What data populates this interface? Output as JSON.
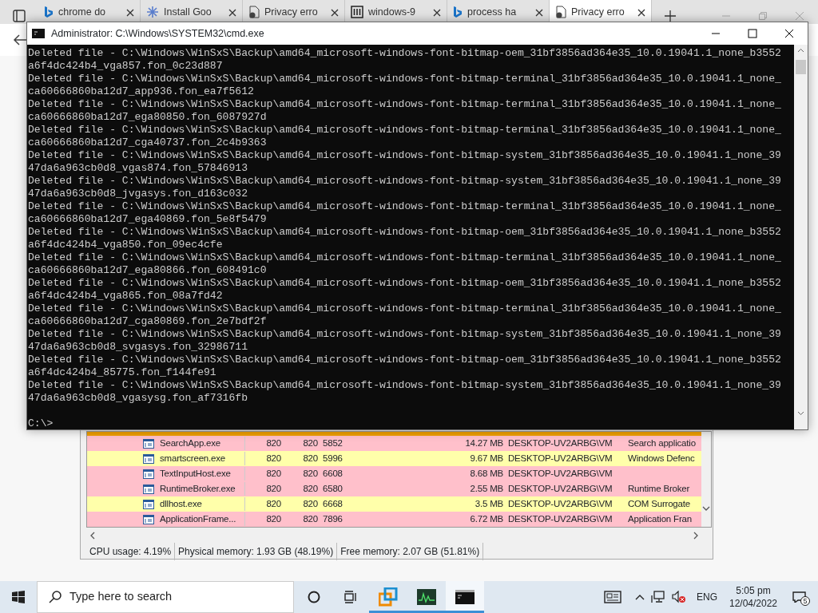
{
  "browser": {
    "tabs": [
      {
        "label": "chrome do",
        "kind": "bing",
        "selected": false
      },
      {
        "label": "Install Goo",
        "kind": "spark",
        "selected": false
      },
      {
        "label": "Privacy erro",
        "kind": "warning",
        "selected": false
      },
      {
        "label": "windows-9",
        "kind": "pillars",
        "selected": false
      },
      {
        "label": "process ha",
        "kind": "bing",
        "selected": false
      },
      {
        "label": "Privacy erro",
        "kind": "warning",
        "selected": true
      }
    ]
  },
  "process_explorer": {
    "rows": [
      {
        "cells": [
          "SearchApp.exe",
          "820",
          "820",
          "5852",
          "14.27 MB",
          "DESKTOP-UV2ARBG\\VM",
          "Search applicatio"
        ],
        "color": "#ffc0cb"
      },
      {
        "cells": [
          "smartscreen.exe",
          "820",
          "820",
          "5996",
          "9.67 MB",
          "DESKTOP-UV2ARBG\\VM",
          "Windows Defenc"
        ],
        "color": "#ffffaa"
      },
      {
        "cells": [
          "TextInputHost.exe",
          "820",
          "820",
          "6608",
          "8.68 MB",
          "DESKTOP-UV2ARBG\\VM"
        ],
        "color": "#ffc0cb"
      },
      {
        "cells": [
          "RuntimeBroker.exe",
          "820",
          "820",
          "6580",
          "2.55 MB",
          "DESKTOP-UV2ARBG\\VM",
          "Runtime Broker"
        ],
        "color": "#ffc0cb"
      },
      {
        "cells": [
          "dllhost.exe",
          "820",
          "820",
          "6668",
          "3.5 MB",
          "DESKTOP-UV2ARBG\\VM",
          "COM Surrogate"
        ],
        "color": "#ffffaa"
      },
      {
        "cells": [
          "ApplicationFrame...",
          "820",
          "820",
          "7896",
          "6.72 MB",
          "DESKTOP-UV2ARBG\\VM",
          "Application Fran"
        ],
        "color": "#ffc0cb"
      }
    ],
    "status_bar": [
      "CPU usage: 4.19%",
      "Physical memory: 1.93 GB (48.19%)",
      "Free memory: 2.07 GB (51.81%)"
    ]
  },
  "cmd": {
    "title": "Administrator: C:\\Windows\\SYSTEM32\\cmd.exe",
    "lines": [
      "Deleted file - C:\\Windows\\WinSxS\\Backup\\amd64_microsoft-windows-font-bitmap-oem_31bf3856ad364e35_10.0.19041.1_none_b3552",
      "a6f4dc424b4_vga857.fon_0c23d887",
      "Deleted file - C:\\Windows\\WinSxS\\Backup\\amd64_microsoft-windows-font-bitmap-terminal_31bf3856ad364e35_10.0.19041.1_none_",
      "ca60666860ba12d7_app936.fon_ea7f5612",
      "Deleted file - C:\\Windows\\WinSxS\\Backup\\amd64_microsoft-windows-font-bitmap-terminal_31bf3856ad364e35_10.0.19041.1_none_",
      "ca60666860ba12d7_ega80850.fon_6087927d",
      "Deleted file - C:\\Windows\\WinSxS\\Backup\\amd64_microsoft-windows-font-bitmap-terminal_31bf3856ad364e35_10.0.19041.1_none_",
      "ca60666860ba12d7_cga40737.fon_2c4b9363",
      "Deleted file - C:\\Windows\\WinSxS\\Backup\\amd64_microsoft-windows-font-bitmap-system_31bf3856ad364e35_10.0.19041.1_none_39",
      "47da6a963cb0d8_vgas874.fon_57846913",
      "Deleted file - C:\\Windows\\WinSxS\\Backup\\amd64_microsoft-windows-font-bitmap-system_31bf3856ad364e35_10.0.19041.1_none_39",
      "47da6a963cb0d8_jvgasys.fon_d163c032",
      "Deleted file - C:\\Windows\\WinSxS\\Backup\\amd64_microsoft-windows-font-bitmap-terminal_31bf3856ad364e35_10.0.19041.1_none_",
      "ca60666860ba12d7_ega40869.fon_5e8f5479",
      "Deleted file - C:\\Windows\\WinSxS\\Backup\\amd64_microsoft-windows-font-bitmap-oem_31bf3856ad364e35_10.0.19041.1_none_b3552",
      "a6f4dc424b4_vga850.fon_09ec4cfe",
      "Deleted file - C:\\Windows\\WinSxS\\Backup\\amd64_microsoft-windows-font-bitmap-terminal_31bf3856ad364e35_10.0.19041.1_none_",
      "ca60666860ba12d7_ega80866.fon_608491c0",
      "Deleted file - C:\\Windows\\WinSxS\\Backup\\amd64_microsoft-windows-font-bitmap-oem_31bf3856ad364e35_10.0.19041.1_none_b3552",
      "a6f4dc424b4_vga865.fon_08a7fd42",
      "Deleted file - C:\\Windows\\WinSxS\\Backup\\amd64_microsoft-windows-font-bitmap-terminal_31bf3856ad364e35_10.0.19041.1_none_",
      "ca60666860ba12d7_cga80869.fon_2e7bdf2f",
      "Deleted file - C:\\Windows\\WinSxS\\Backup\\amd64_microsoft-windows-font-bitmap-system_31bf3856ad364e35_10.0.19041.1_none_39",
      "47da6a963cb0d8_svgasys.fon_32986711",
      "Deleted file - C:\\Windows\\WinSxS\\Backup\\amd64_microsoft-windows-font-bitmap-oem_31bf3856ad364e35_10.0.19041.1_none_b3552",
      "a6f4dc424b4_85775.fon_f144fe91",
      "Deleted file - C:\\Windows\\WinSxS\\Backup\\amd64_microsoft-windows-font-bitmap-system_31bf3856ad364e35_10.0.19041.1_none_39",
      "47da6a963cb0d8_vgasysg.fon_af7316fb"
    ],
    "prompt": "C:\\>"
  },
  "taskbar": {
    "search": {
      "placeholder": "Type here to search"
    },
    "apps": [
      {
        "kind": "vm",
        "selected": false
      },
      {
        "kind": "monitor",
        "selected": false
      },
      {
        "kind": "console",
        "selected": true
      }
    ],
    "language": "ENG",
    "time": "5:05 pm",
    "date": "12/04/2022",
    "notifications": "5"
  }
}
